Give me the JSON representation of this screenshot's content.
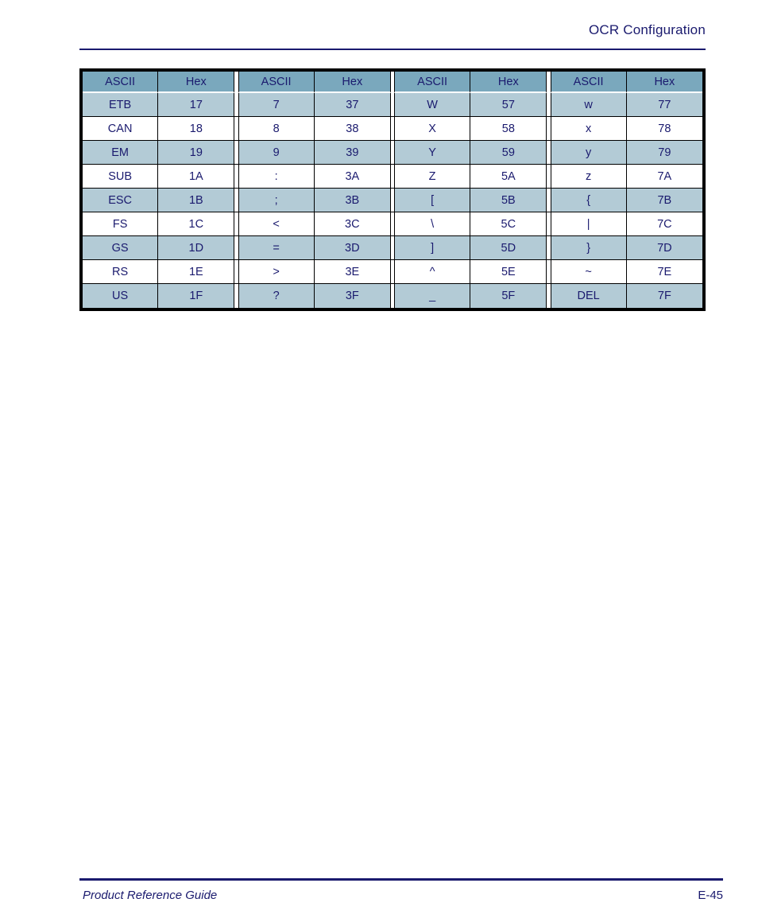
{
  "header": {
    "title": "OCR Configuration"
  },
  "footer": {
    "left_label": "Product Reference Guide",
    "page_number": "E-45"
  },
  "colors": {
    "text_navy": "#1a1a6e",
    "header_row_fill": "#7aa8bd",
    "tinted_row_fill": "#b3cbd6",
    "plain_row_fill": "#ffffff",
    "border": "#000000"
  },
  "table": {
    "column_headers": [
      "ASCII",
      "Hex",
      "ASCII",
      "Hex",
      "ASCII",
      "Hex",
      "ASCII",
      "Hex"
    ],
    "rows": [
      {
        "tinted": true,
        "cells": [
          "ETB",
          "17",
          "7",
          "37",
          "W",
          "57",
          "w",
          "77"
        ]
      },
      {
        "tinted": false,
        "cells": [
          "CAN",
          "18",
          "8",
          "38",
          "X",
          "58",
          "x",
          "78"
        ]
      },
      {
        "tinted": true,
        "cells": [
          "EM",
          "19",
          "9",
          "39",
          "Y",
          "59",
          "y",
          "79"
        ]
      },
      {
        "tinted": false,
        "cells": [
          "SUB",
          "1A",
          ":",
          "3A",
          "Z",
          "5A",
          "z",
          "7A"
        ]
      },
      {
        "tinted": true,
        "cells": [
          "ESC",
          "1B",
          ";",
          "3B",
          "[",
          "5B",
          "{",
          "7B"
        ]
      },
      {
        "tinted": false,
        "cells": [
          "FS",
          "1C",
          "<",
          "3C",
          "\\",
          "5C",
          "|",
          "7C"
        ]
      },
      {
        "tinted": true,
        "cells": [
          "GS",
          "1D",
          "=",
          "3D",
          "]",
          "5D",
          "}",
          "7D"
        ]
      },
      {
        "tinted": false,
        "cells": [
          "RS",
          "1E",
          ">",
          "3E",
          "^",
          "5E",
          "~",
          "7E"
        ]
      },
      {
        "tinted": true,
        "cells": [
          "US",
          "1F",
          "?",
          "3F",
          "_",
          "5F",
          "DEL",
          "7F"
        ]
      }
    ]
  }
}
